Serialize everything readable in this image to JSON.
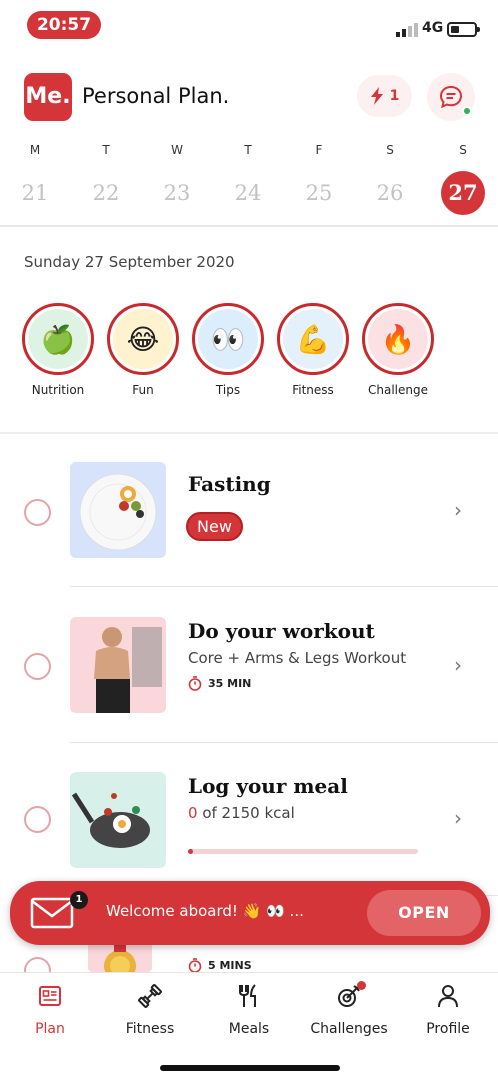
{
  "status_bar": {
    "time": "20:57",
    "network": "4G",
    "battery_level": 0.35
  },
  "header": {
    "logo_text": "Me.",
    "title": "Personal Plan.",
    "streak_count": "1"
  },
  "week": [
    {
      "letter": "M",
      "date": "21"
    },
    {
      "letter": "T",
      "date": "22"
    },
    {
      "letter": "W",
      "date": "23"
    },
    {
      "letter": "T",
      "date": "24"
    },
    {
      "letter": "F",
      "date": "25"
    },
    {
      "letter": "S",
      "date": "26"
    },
    {
      "letter": "S",
      "date": "27",
      "active": true
    }
  ],
  "date_label": "Sunday 27 September 2020",
  "stories": [
    {
      "label": "Nutrition",
      "emoji": "🍏",
      "bg": "#dff3e4"
    },
    {
      "label": "Fun",
      "emoji": "😂",
      "bg": "#fff2cf"
    },
    {
      "label": "Tips",
      "emoji": "👀",
      "bg": "#dceefb"
    },
    {
      "label": "Fitness",
      "emoji": "💪",
      "bg": "#e4f1fb"
    },
    {
      "label": "Challenge",
      "emoji": "🔥",
      "bg": "#fbe1e3"
    }
  ],
  "tasks": {
    "fasting": {
      "title": "Fasting",
      "badge": "New"
    },
    "workout": {
      "title": "Do your workout",
      "subtitle": "Core + Arms & Legs Workout",
      "duration": "35 MIN"
    },
    "meal": {
      "title": "Log your meal",
      "consumed": "0",
      "of_text": "of 2150 kcal",
      "progress": 0.02
    },
    "next": {
      "duration": "5 MINS"
    }
  },
  "toast": {
    "count": "1",
    "message": "Welcome aboard! 👋 👀 ...",
    "action": "OPEN"
  },
  "tabs": [
    {
      "label": "Plan",
      "icon": "plan-icon",
      "active": true
    },
    {
      "label": "Fitness",
      "icon": "dumbbell-icon"
    },
    {
      "label": "Meals",
      "icon": "cutlery-icon"
    },
    {
      "label": "Challenges",
      "icon": "challenges-icon"
    },
    {
      "label": "Profile",
      "icon": "profile-icon"
    }
  ],
  "colors": {
    "accent": "#d43538",
    "online": "#2bb35a"
  }
}
